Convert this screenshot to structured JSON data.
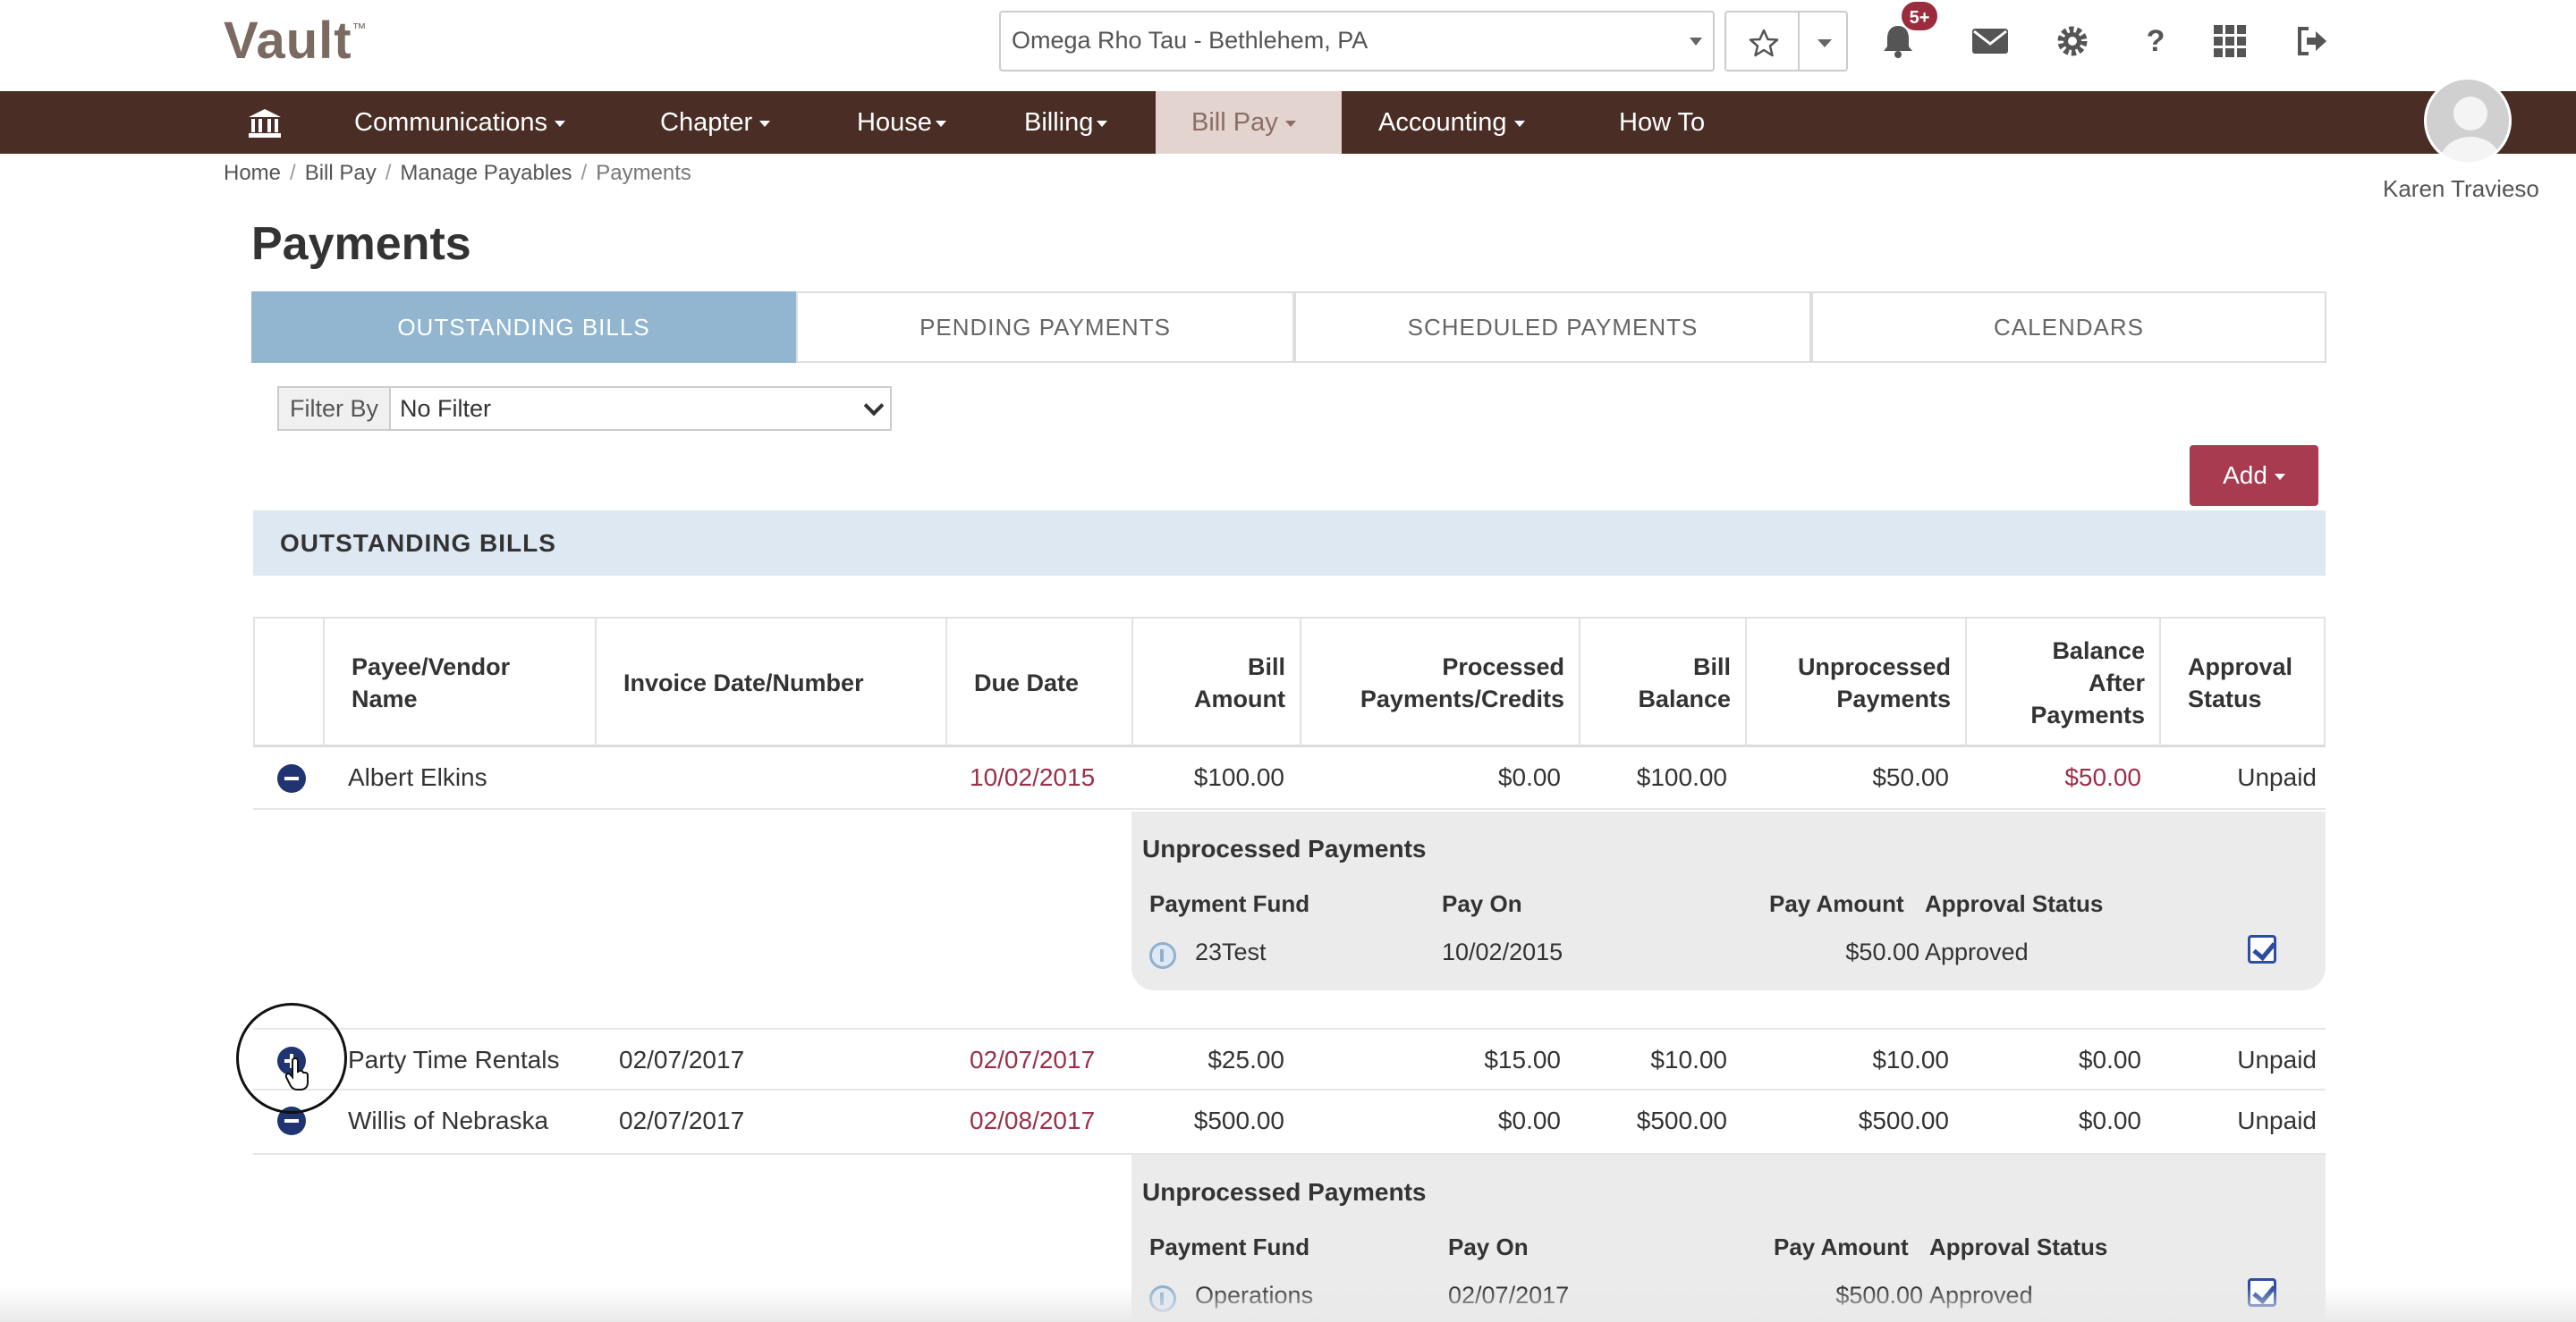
{
  "app": {
    "logo": "Vault",
    "logo_tm": "™"
  },
  "header": {
    "chapter_selector": "Omega Rho Tau - Bethlehem, PA",
    "notifications_badge": "5+",
    "icons": [
      "star-icon",
      "chevron-down-icon",
      "bell-icon",
      "envelope-icon",
      "gear-icon",
      "help-icon",
      "grid-icon",
      "sign-out-icon"
    ]
  },
  "nav": {
    "items": [
      {
        "label": "Communications"
      },
      {
        "label": "Chapter"
      },
      {
        "label": "House"
      },
      {
        "label": "Billing"
      },
      {
        "label": "Bill Pay"
      },
      {
        "label": "Accounting"
      },
      {
        "label": "How To"
      }
    ],
    "active": "Bill Pay"
  },
  "user": {
    "name": "Karen Travieso"
  },
  "breadcrumb": [
    "Home",
    "Bill Pay",
    "Manage Payables",
    "Payments"
  ],
  "page": {
    "title": "Payments"
  },
  "tabs": [
    "OUTSTANDING BILLS",
    "PENDING PAYMENTS",
    "SCHEDULED PAYMENTS",
    "CALENDARS"
  ],
  "filter": {
    "label": "Filter By",
    "value": "No Filter"
  },
  "add_button": {
    "label": "Add"
  },
  "section": {
    "title": "OUTSTANDING BILLS"
  },
  "table": {
    "headers": {
      "payee_line1": "Payee/Vendor",
      "payee_line2": "Name",
      "invoice": "Invoice Date/Number",
      "due": "Due Date",
      "bill_amount_line1": "Bill",
      "bill_amount_line2": "Amount",
      "processed_line1": "Processed",
      "processed_line2": "Payments/Credits",
      "bill_balance_line1": "Bill",
      "bill_balance_line2": "Balance",
      "unprocessed_line1": "Unprocessed",
      "unprocessed_line2": "Payments",
      "after_line1": "Balance",
      "after_line2": "After",
      "after_line3": "Payments",
      "approval_line1": "Approval",
      "approval_line2": "Status"
    },
    "rows": [
      {
        "payee": "Albert Elkins",
        "invoice": "",
        "due": "10/02/2015",
        "bill_amount": "$100.00",
        "processed": "$0.00",
        "bill_balance": "$100.00",
        "unprocessed": "$50.00",
        "after": "$50.00",
        "status": "Unpaid"
      },
      {
        "payee": "Party Time Rentals",
        "invoice": "02/07/2017",
        "due": "02/07/2017",
        "bill_amount": "$25.00",
        "processed": "$15.00",
        "bill_balance": "$10.00",
        "unprocessed": "$10.00",
        "after": "$0.00",
        "status": "Unpaid"
      },
      {
        "payee": "Willis of Nebraska",
        "invoice": "02/07/2017",
        "due": "02/08/2017",
        "bill_amount": "$500.00",
        "processed": "$0.00",
        "bill_balance": "$500.00",
        "unprocessed": "$500.00",
        "after": "$0.00",
        "status": "Unpaid"
      }
    ],
    "subpanels": [
      {
        "title": "Unprocessed Payments",
        "headers": {
          "fund": "Payment Fund",
          "pay_on": "Pay On",
          "amount": "Pay Amount",
          "status": "Approval Status"
        },
        "row": {
          "fund": "23Test",
          "pay_on": "10/02/2015",
          "amount": "$50.00",
          "status": "Approved",
          "checked": true
        }
      },
      {
        "title": "Unprocessed Payments",
        "headers": {
          "fund": "Payment Fund",
          "pay_on": "Pay On",
          "amount": "Pay Amount",
          "status": "Approval Status"
        },
        "row": {
          "fund": "Operations",
          "pay_on": "02/07/2017",
          "amount": "$500.00",
          "status": "Approved",
          "checked": true
        }
      }
    ]
  },
  "colors": {
    "nav_bg": "#4a2e26",
    "tab_active": "#92b5d0",
    "accent_red": "#9b3048",
    "add_button": "#a83b4f",
    "section_head": "#dde8f3"
  }
}
